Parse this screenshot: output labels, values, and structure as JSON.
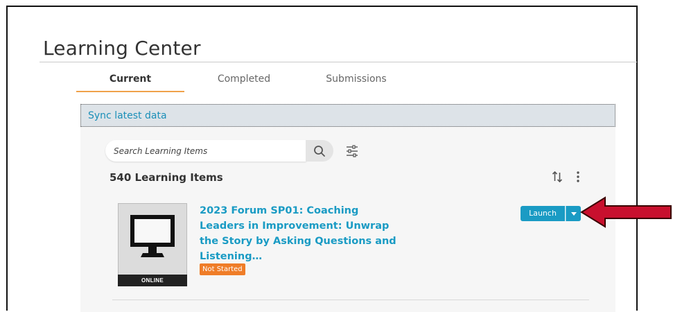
{
  "page": {
    "title": "Learning Center"
  },
  "tabs": [
    {
      "label": "Current",
      "active": true
    },
    {
      "label": "Completed",
      "active": false
    },
    {
      "label": "Submissions",
      "active": false
    }
  ],
  "sync": {
    "label": "Sync latest data"
  },
  "search": {
    "placeholder": "Search Learning Items",
    "value": ""
  },
  "icons": {
    "search": "search-icon",
    "filter": "filter-sliders-icon",
    "sort": "sort-icon",
    "more": "more-vertical-icon",
    "caret": "chevron-down-icon",
    "thumbnail": "monitor-icon"
  },
  "results": {
    "count_label": "540 Learning Items"
  },
  "items": [
    {
      "title": "2023 Forum SP01: Coaching Leaders in Improvement: Unwrap the Story by Asking Questions and Listening…",
      "status": "Not Started",
      "type_label": "ONLINE",
      "action_label": "Launch"
    }
  ],
  "colors": {
    "accent": "#1a9bc4",
    "tab_underline": "#f0a24a",
    "badge": "#ef7d28",
    "annotation_arrow": "#c8102e"
  }
}
